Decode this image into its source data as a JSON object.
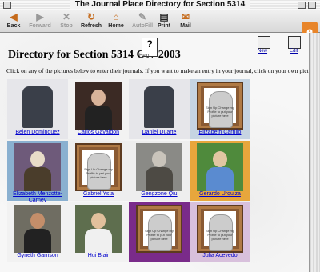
{
  "window": {
    "title": "The Journal Place Directory for Section 5314"
  },
  "toolbar": {
    "buttons": [
      {
        "label": "Back",
        "icon": "back-arrow",
        "enabled": true
      },
      {
        "label": "Forward",
        "icon": "forward-arrow",
        "enabled": false
      },
      {
        "label": "Stop",
        "icon": "stop-x",
        "enabled": false
      },
      {
        "label": "Refresh",
        "icon": "refresh",
        "enabled": true
      },
      {
        "label": "Home",
        "icon": "home",
        "enabled": true
      },
      {
        "label": "AutoFill",
        "icon": "autofill",
        "enabled": false
      },
      {
        "label": "Print",
        "icon": "print",
        "enabled": true
      },
      {
        "label": "Mail",
        "icon": "mail",
        "enabled": true
      }
    ]
  },
  "page": {
    "heading": "Directory for Section 5314 CW 2003",
    "help_label": "Help",
    "right_icons": [
      {
        "label": "New"
      },
      {
        "label": "Edit"
      }
    ],
    "instructions": "Click on any of the pictures below to enter their journals. If you want to make an entry in your journal, click on your own picture"
  },
  "colors": {
    "accent": "#e8852a",
    "link": "#0000cc"
  },
  "students": [
    {
      "name": "Belen Dominguez",
      "photo": "shirt",
      "bg": "#e6e6ea"
    },
    {
      "name": "Carlos Gavaldon",
      "photo": "couple",
      "bg": "#f2f2f2"
    },
    {
      "name": "Daniel Duarte",
      "photo": "shirt",
      "bg": "#e6e6ea"
    },
    {
      "name": "Elizabeth Carrillo",
      "photo": "frame",
      "bg": "#c6d4e2"
    },
    {
      "name": "Elizabeth Menzotte-Carney",
      "photo": "portrait",
      "bg": "#8ab0d0"
    },
    {
      "name": "Gabriel Ysla",
      "photo": "frame",
      "bg": "#eeeeee"
    },
    {
      "name": "Gengzone Qiu",
      "photo": "group",
      "bg": "#eeeeee"
    },
    {
      "name": "Gerardo Urquiza",
      "photo": "couple-outdoor",
      "bg": "#e7a63c"
    },
    {
      "name": "Gyneth Garrison",
      "photo": "person",
      "bg": "#f2f2f2"
    },
    {
      "name": "Hui Blair",
      "photo": "person-light",
      "bg": "#f2f2f2"
    },
    {
      "name": "",
      "photo": "frame",
      "bg": "#7a2b8a"
    },
    {
      "name": "Julia Acevedo",
      "photo": "frame",
      "bg": "#d8c0dc"
    }
  ],
  "frame_text": "Sign Up Change my Profile to put your picture here"
}
